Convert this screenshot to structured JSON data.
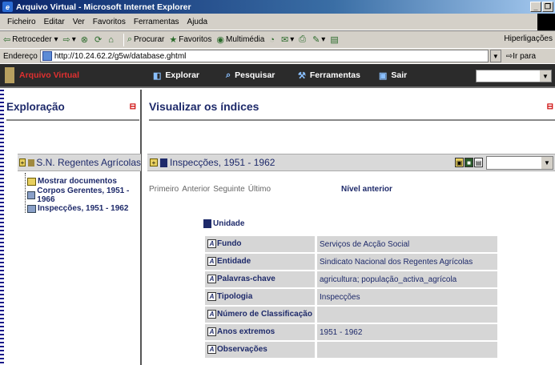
{
  "window": {
    "title": "Arquivo Virtual - Microsoft Internet Explorer",
    "controls": [
      "_",
      "❐"
    ]
  },
  "menubar": [
    "Ficheiro",
    "Editar",
    "Ver",
    "Favoritos",
    "Ferramentas",
    "Ajuda"
  ],
  "toolbar": {
    "back": "Retroceder",
    "search": "Procurar",
    "favorites": "Favoritos",
    "media": "Multimédia",
    "links": "Hiperligações"
  },
  "address": {
    "label": "Endereço",
    "url": "http://10.24.62.2/g5w/database.ghtml",
    "go": "Ir para"
  },
  "appnav": {
    "brand": "Arquivo Virtual",
    "items": [
      {
        "label": "Explorar",
        "icon": "explore-icon"
      },
      {
        "label": "Pesquisar",
        "icon": "search-icon"
      },
      {
        "label": "Ferramentas",
        "icon": "tools-icon"
      },
      {
        "label": "Sair",
        "icon": "exit-icon"
      }
    ]
  },
  "left": {
    "title": "Exploração",
    "collapse": "⊟",
    "root": "S.N. Regentes Agrícolas",
    "children": [
      "Mostrar documentos",
      "Corpos Gerentes, 1951 - 1966",
      "Inspecções, 1951 - 1962"
    ]
  },
  "main": {
    "title": "Visualizar os índices",
    "collapse": "⊟",
    "record_title": "Inspecções, 1951 - 1962",
    "pager": [
      "Primeiro",
      "Anterior",
      "Seguinte",
      "Último"
    ],
    "parent_level": "Nível anterior",
    "unit_label": "Unidade",
    "fields": [
      {
        "label": "Fundo",
        "value": "Serviços de Acção Social"
      },
      {
        "label": "Entidade",
        "value": "Sindicato Nacional dos Regentes Agrícolas"
      },
      {
        "label": "Palavras-chave",
        "value": "agricultura; população_activa_agrícola"
      },
      {
        "label": "Tipologia",
        "value": "Inspecções"
      },
      {
        "label": "Número de Classificação",
        "value": ""
      },
      {
        "label": "Anos extremos",
        "value": "1951 - 1962"
      },
      {
        "label": "Observações",
        "value": ""
      }
    ]
  }
}
